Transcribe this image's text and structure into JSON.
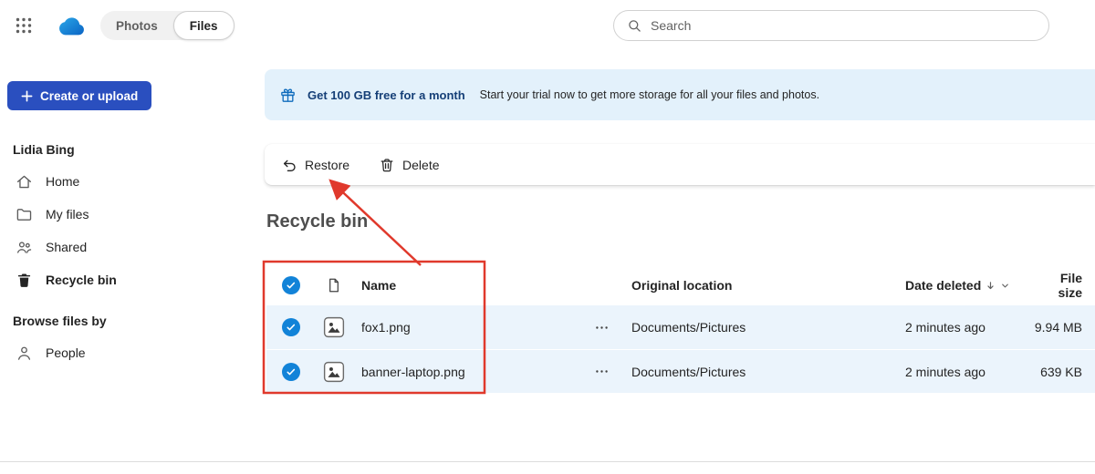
{
  "topbar": {
    "toggle": {
      "photos_label": "Photos",
      "files_label": "Files"
    },
    "search": {
      "placeholder": "Search"
    }
  },
  "sidebar": {
    "create_button_label": "Create or upload",
    "user_name": "Lidia Bing",
    "nav": [
      {
        "label": "Home"
      },
      {
        "label": "My files"
      },
      {
        "label": "Shared"
      },
      {
        "label": "Recycle bin"
      }
    ],
    "browse_heading": "Browse files by",
    "browse_nav": [
      {
        "label": "People"
      }
    ]
  },
  "banner": {
    "title": "Get 100 GB free for a month",
    "subtitle": "Start your trial now to get more storage for all your files and photos."
  },
  "toolbar": {
    "restore_label": "Restore",
    "delete_label": "Delete"
  },
  "page_title": "Recycle bin",
  "table": {
    "headers": {
      "name": "Name",
      "original_location": "Original location",
      "date_deleted": "Date deleted",
      "file_size": "File size"
    },
    "rows": [
      {
        "name": "fox1.png",
        "original_location": "Documents/Pictures",
        "date_deleted": "2 minutes ago",
        "file_size": "9.94 MB",
        "selected": true
      },
      {
        "name": "banner-laptop.png",
        "original_location": "Documents/Pictures",
        "date_deleted": "2 minutes ago",
        "file_size": "639 KB",
        "selected": true
      }
    ]
  },
  "colors": {
    "accent_blue": "#0f6cbd",
    "checkbox_blue": "#1283d8",
    "selected_row_bg": "#ebf4fc",
    "banner_bg": "#e3f1fb",
    "create_button_bg": "#2a4fbf",
    "annotation_red": "#e0392c"
  }
}
